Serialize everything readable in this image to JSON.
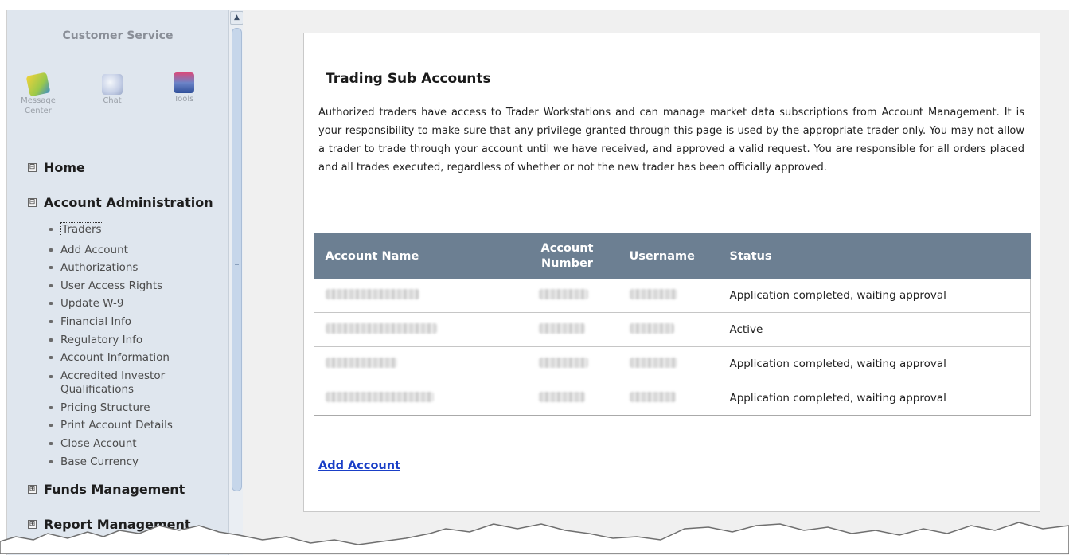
{
  "sidebar": {
    "customer_service_title": "Customer Service",
    "tools": [
      {
        "label_line1": "Message",
        "label_line2": "Center",
        "icon": "message-center-icon"
      },
      {
        "label_line1": "Chat",
        "label_line2": "",
        "icon": "chat-icon"
      },
      {
        "label_line1": "Tools",
        "label_line2": "",
        "icon": "tools-icon"
      }
    ],
    "sections": {
      "home": {
        "label": "Home",
        "state": "expanded",
        "toggle": "⊟"
      },
      "account_admin": {
        "label": "Account Administration",
        "state": "expanded",
        "toggle": "⊟"
      },
      "funds": {
        "label": "Funds Management",
        "state": "collapsed",
        "toggle": "⊞"
      },
      "reports": {
        "label": "Report Management",
        "state": "collapsed",
        "toggle": "⊞"
      }
    },
    "items": [
      "Traders",
      "Add Account",
      "Authorizations",
      "User Access Rights",
      "Update W-9",
      "Financial Info",
      "Regulatory Info",
      "Account Information",
      "Accredited Investor Qualifications",
      "Pricing Structure",
      "Print Account Details",
      "Close Account",
      "Base Currency"
    ],
    "selected_item": "Traders"
  },
  "main": {
    "title": "Trading Sub Accounts",
    "description": "Authorized traders have access to Trader Workstations and can manage market data subscriptions from Account Management. It is your responsibility to make sure that any privilege granted through this page is used by the appropriate trader only. You may not allow a trader to trade through your account until we have received, and approved a valid request. You are responsible for all orders placed and all trades executed, regardless of whether or not the new trader has been officially approved.",
    "table": {
      "headers": {
        "account_name": "Account Name",
        "account_number_l1": "Account",
        "account_number_l2": "Number",
        "username": "Username",
        "status": "Status"
      },
      "rows": [
        {
          "status": "Application completed, waiting approval"
        },
        {
          "status": "Active"
        },
        {
          "status": "Application completed, waiting approval"
        },
        {
          "status": "Application completed, waiting approval"
        }
      ]
    },
    "add_account_link": "Add Account"
  },
  "colors": {
    "sidebar_bg": "#dfe6ee",
    "table_header_bg": "#6c7f92",
    "link": "#1a3fc7"
  }
}
